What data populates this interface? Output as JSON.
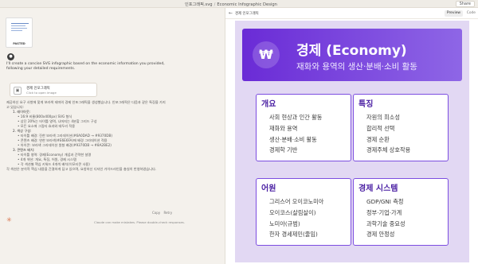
{
  "topbar": {
    "file": "인포그래픽.svg",
    "title": "Economic Infographic Design",
    "share": "Share"
  },
  "chat": {
    "thumb_tag": "PASTED",
    "intro": "I'll create a concise SVG infographic based on the economic information you provided, following your detailed requirements.",
    "artifact_title": "경제 인포그래픽",
    "artifact_sub": "Click to open image",
    "body_lead": "제공하신 요구 사항에 맞게 보라색 테마의 경제 인포그래픽을 생성했습니다. 인포그래픽은 다음과 같은 특징을 가지고 있습니다:",
    "sections": [
      {
        "title": "1. 레이아웃:",
        "items": [
          "• 16:9 비율(800x400px) SVG 형식",
          "• 상단 20%는 타이틀 영역, 나머지는 4분할 그리드 구성",
          "• 모든 요소에 그림자 효과와 테두리 적용"
        ]
      },
      {
        "title": "2. 색상 구성:",
        "items": [
          "• 타이틀 배경: 진한 보라색 그라데이션(#6A0DAD → #9370DB)",
          "• 콘텐츠 배경: 연한 보라색(#E6E6FA)에 배경 그라데이션 적용",
          "• 아이콘: 보라색 그라데이션 원형 배경(#9370DB → #8A2BE2)"
        ]
      },
      {
        "title": "3. 콘텐츠 배치:",
        "items": [
          "• 타이틀 영역: 경제(Economy) 개념과 간략한 설명",
          "• 4개 섹션: 개요, 특징, 어원, 경제 시스템",
          "• 각 섹션별 핵심 키워드 4개씩 배치(이모티콘 사용)"
        ]
      }
    ],
    "closing": "각 섹션은 분석적 핵심 내용을 간결하게 담고 있으며, 요청하신 디자인 가이드라인을 충실히 반영하였습니다.",
    "retry": "Retry",
    "copy": "Copy",
    "disclaimer": "Claude can make mistakes. Please double-check responses."
  },
  "panel": {
    "title": "경제 인포그래픽",
    "preview": "Preview",
    "code": "Code"
  },
  "infographic": {
    "icon": "₩",
    "title": "경제 (Economy)",
    "subtitle": "재화와 용역의 생산·분배·소비 활동",
    "cards": [
      {
        "title": "개요",
        "items": [
          "사회 현상과 인간 활동",
          "재화와 용역",
          "생산·분배·소비 활동",
          "경제학 기반"
        ]
      },
      {
        "title": "특징",
        "items": [
          "자원의 희소성",
          "합리적 선택",
          "경제 순환",
          "경제주체 상호작용"
        ]
      },
      {
        "title": "어원",
        "items": [
          "그리스어 오이코노미아",
          "오이코스(살림살이)",
          "노미아(규범)",
          "한자 경세제민(줄임)"
        ]
      },
      {
        "title": "경제 시스템",
        "items": [
          "GDP/GNI 측정",
          "정부·기업·가계",
          "과학기술 중요성",
          "경제 안정성"
        ]
      }
    ]
  }
}
